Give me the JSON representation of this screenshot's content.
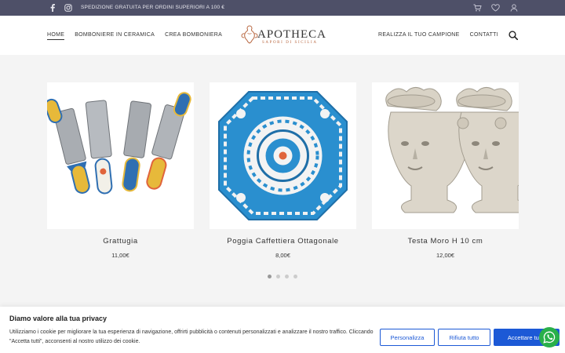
{
  "topbar": {
    "promo": "SPEDIZIONE GRATUITA PER ORDINI SUPERIORI A 100 €",
    "social_icons": [
      "facebook-icon",
      "instagram-icon"
    ],
    "tool_icons": [
      "cart-icon",
      "heart-icon",
      "user-icon"
    ]
  },
  "nav": {
    "left": [
      "HOME",
      "BOMBONIERE IN CERAMICA",
      "CREA BOMBONIERA"
    ],
    "right": [
      "REALIZZA IL TUO CAMPIONE",
      "CONTATTI"
    ],
    "active": "HOME"
  },
  "logo": {
    "name": "APOTHECA",
    "tagline": "SAPORI DI SICILIA"
  },
  "products": [
    {
      "title": "Grattugia",
      "price": "11,00€"
    },
    {
      "title": "Poggia Caffettiera Ottagonale",
      "price": "8,00€"
    },
    {
      "title": "Testa Moro H 10 cm",
      "price": "12,00€"
    }
  ],
  "carousel": {
    "pages": 4,
    "active_index": 0
  },
  "cookie": {
    "title": "Diamo valore alla tua privacy",
    "text": "Utilizziamo i cookie per migliorare la tua esperienza di navigazione, offrirti pubblicità o contenuti personalizzati e analizzare il nostro traffico. Cliccando \"Accetta tutti\", acconsenti al nostro utilizzo dei cookie.",
    "buttons": {
      "customize": "Personalizza",
      "reject": "Rifiuta tutto",
      "accept": "Accettare tutto"
    }
  },
  "colors": {
    "topbar": "#4e5068",
    "accent_blue": "#1c59d6",
    "whatsapp": "#2ab04a",
    "logo_accent": "#b7643c"
  }
}
